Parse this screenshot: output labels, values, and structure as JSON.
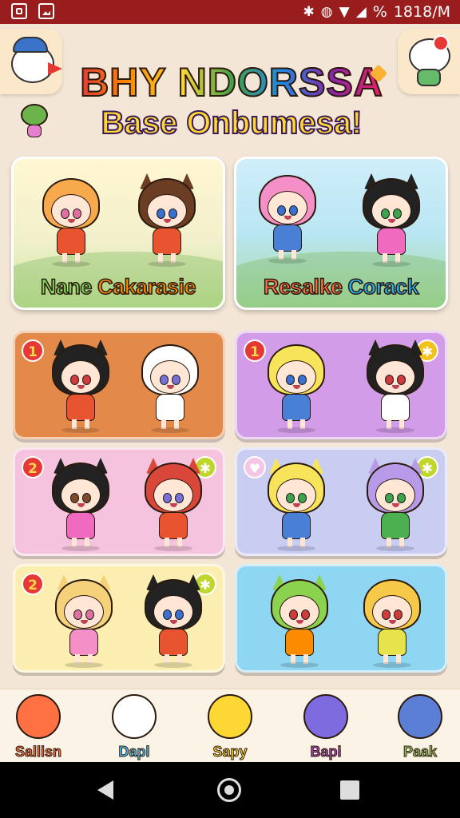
{
  "status_bar": {
    "clock": "1818/M",
    "battery_symbol": "%",
    "icons": [
      "screenshot-icon",
      "image-icon",
      "bluetooth-icon",
      "vibrate-icon",
      "wifi-icon",
      "signal-icon"
    ]
  },
  "header": {
    "title_line1": "BHY NDORSSA",
    "title_line2": "Base Onbumesa!"
  },
  "feature_cards": [
    {
      "label_part1": "Nane ",
      "label_part2": "Cakarasie"
    },
    {
      "label_part1": "Resalke ",
      "label_part2": "Corack"
    }
  ],
  "grid_cards": [
    {
      "badge": "1",
      "corner": ""
    },
    {
      "badge": "1",
      "corner": "star"
    },
    {
      "badge": "2",
      "corner": "star"
    },
    {
      "badge": "",
      "corner": "star"
    },
    {
      "badge": "2",
      "corner": "star"
    },
    {
      "badge": "",
      "corner": ""
    }
  ],
  "bottom_nav": [
    {
      "label": "Sallisn",
      "color": "#ff7043"
    },
    {
      "label": "Dapl",
      "color": "#4fc3f7"
    },
    {
      "label": "Sapy",
      "color": "#fdd835"
    },
    {
      "label": "Bapi",
      "color": "#ab47bc"
    },
    {
      "label": "Paak",
      "color": "#9ccc65"
    }
  ],
  "colors": {
    "status_bar": "#9a1d1d",
    "background": "#f3e6d6",
    "card_orange": "#e38a4a",
    "card_purple": "#d39ce8",
    "card_pink": "#f6c3de",
    "card_lavender": "#c9cdf2",
    "card_yellow": "#fbeeb0",
    "card_blue": "#8fd6f2"
  }
}
